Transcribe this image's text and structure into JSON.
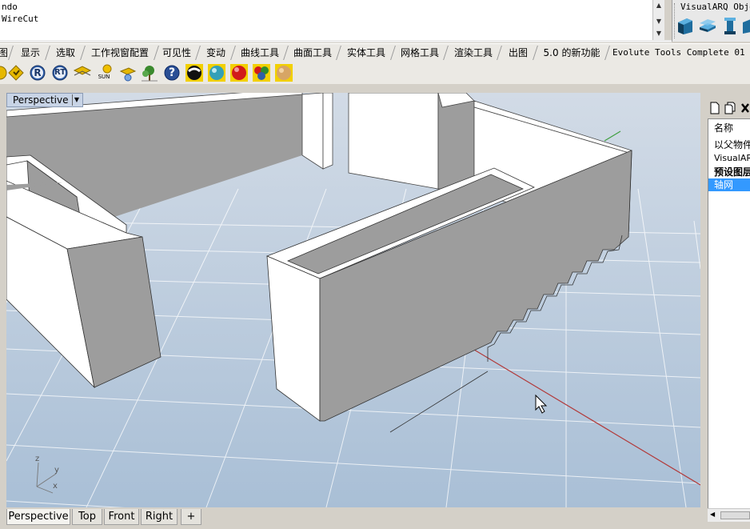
{
  "command_history": {
    "lines": [
      "ndo",
      " WireCut"
    ]
  },
  "visualarq": {
    "title": "VisualARQ Objec",
    "icons": [
      "varq-wall-icon",
      "varq-slab-icon",
      "varq-column-icon",
      "varq-beam-icon"
    ]
  },
  "tabs": [
    {
      "label": "图"
    },
    {
      "label": "显示"
    },
    {
      "label": "选取"
    },
    {
      "label": "工作视窗配置"
    },
    {
      "label": "可见性"
    },
    {
      "label": "变动"
    },
    {
      "label": "曲线工具"
    },
    {
      "label": "曲面工具"
    },
    {
      "label": "实体工具"
    },
    {
      "label": "网格工具"
    },
    {
      "label": "渲染工具"
    },
    {
      "label": "出图"
    },
    {
      "label": "5.0 的新功能"
    },
    {
      "label": "Evolute Tools Complete 01"
    }
  ],
  "toolbar": {
    "icons": [
      "render-arrow-icon",
      "render-tag-icon",
      "render-r-icon",
      "render-rt-icon",
      "light-icon",
      "sun-icon",
      "spotlight-icon",
      "tree-icon",
      "help-icon",
      "environment-icon",
      "material-ball-icon",
      "red-ball-icon",
      "multi-ball-icon",
      "texture-ball-icon"
    ],
    "r_label": "R",
    "rt_label": "RT",
    "sun_label": "SUN",
    "help_label": "?"
  },
  "viewport": {
    "title": "Perspective",
    "axis": {
      "z": "z",
      "y": "y",
      "x": "x"
    }
  },
  "viewport_tabs": [
    {
      "label": "Perspective",
      "active": true
    },
    {
      "label": "Top"
    },
    {
      "label": "Front"
    },
    {
      "label": "Right"
    },
    {
      "label": "+"
    }
  ],
  "layers_panel": {
    "header": "名称",
    "rows": [
      {
        "label": "以父物件"
      },
      {
        "label": "VisualARQ"
      },
      {
        "label": "预设图层"
      },
      {
        "label": "轴网",
        "selected": true
      }
    ]
  },
  "colors": {
    "selection": "#3399ff",
    "viewport_bg_top": "#d2dbe6",
    "viewport_bg_bottom": "#a9bfd6",
    "wall_face": "#9d9d9d",
    "wall_top": "#ffffff",
    "x_axis": "#b23a3a",
    "y_axis": "#3f9f3f"
  }
}
